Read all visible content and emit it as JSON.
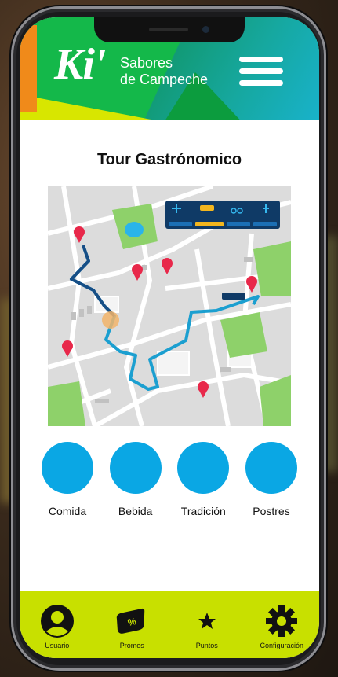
{
  "app": {
    "logo_mark": "Ki'",
    "logo_line1": "Sabores",
    "logo_line2": "de Campeche"
  },
  "page": {
    "title": "Tour Gastrónomico"
  },
  "map": {
    "transport_modes": [
      "plane-icon",
      "taxi-icon",
      "bike-icon",
      "walk-icon"
    ],
    "selected_mode": "taxi-icon"
  },
  "categories": [
    {
      "label": "Comida"
    },
    {
      "label": "Bebida"
    },
    {
      "label": "Tradición"
    },
    {
      "label": "Postres"
    }
  ],
  "nav": [
    {
      "label": "Usuario",
      "icon": "user-icon"
    },
    {
      "label": "Promos",
      "icon": "promo-tag-icon"
    },
    {
      "label": "Puntos",
      "icon": "star-icon"
    },
    {
      "label": "Configuración",
      "icon": "gear-icon"
    }
  ],
  "colors": {
    "header_green": "#14b84a",
    "accent_lime": "#c8e000",
    "category_blue": "#0aa7e4",
    "route_blue": "#1b9fd0",
    "pin_red": "#e8284a"
  }
}
